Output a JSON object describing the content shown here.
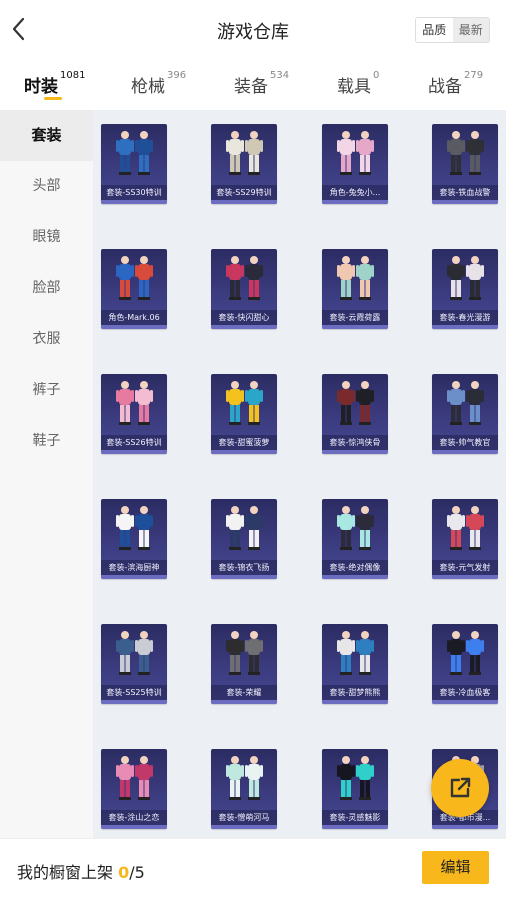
{
  "header": {
    "title": "游戏仓库",
    "toggle": [
      "品质",
      "最新"
    ]
  },
  "tabs": [
    {
      "label": "时装",
      "count": "1081"
    },
    {
      "label": "枪械",
      "count": "396"
    },
    {
      "label": "装备",
      "count": "534"
    },
    {
      "label": "载具",
      "count": "0"
    },
    {
      "label": "战备",
      "count": "279"
    }
  ],
  "sidebar": {
    "items": [
      "套装",
      "头部",
      "眼镜",
      "脸部",
      "衣服",
      "裤子",
      "鞋子"
    ]
  },
  "items": [
    {
      "label": "套装-SS30特训",
      "icon": "blue-suit-pair"
    },
    {
      "label": "套装-SS29特训",
      "icon": "white-suit-pair"
    },
    {
      "label": "角色-兔兔小...",
      "icon": "bunny-girl-figure"
    },
    {
      "label": "套装-铁血战警",
      "icon": "armor-suit-pair"
    },
    {
      "label": "角色-Mark.06",
      "icon": "blue-hero-figure"
    },
    {
      "label": "套装-快闪甜心",
      "icon": "pink-dark-suit-pair"
    },
    {
      "label": "套装-云霞荷露",
      "icon": "pastel-dress-pair"
    },
    {
      "label": "套装-春光漫游",
      "icon": "dark-suit-pair"
    },
    {
      "label": "套装-SS26特训",
      "icon": "pink-suit-pair"
    },
    {
      "label": "套装-甜蜜菠萝",
      "icon": "pineapple-costume-set"
    },
    {
      "label": "套装-惊鸿侠骨",
      "icon": "dark-robe-pair"
    },
    {
      "label": "套装-帅气教官",
      "icon": "blue-jacket-set"
    },
    {
      "label": "套装-滨海厨神",
      "icon": "chef-outfit"
    },
    {
      "label": "套装-锦衣飞扬",
      "icon": "white-robe-pair"
    },
    {
      "label": "套装-绝对偶像",
      "icon": "idol-pair"
    },
    {
      "label": "套装-元气发射",
      "icon": "red-white-pair"
    },
    {
      "label": "套装-SS25特训",
      "icon": "blue-camo-pair"
    },
    {
      "label": "套装-荣耀",
      "icon": "black-jacket-set"
    },
    {
      "label": "套装-甜梦熊熊",
      "icon": "bear-pajama-pair"
    },
    {
      "label": "套装-冷血极客",
      "icon": "black-tech-pair"
    },
    {
      "label": "套装-涂山之恋",
      "icon": "pink-fox-pair"
    },
    {
      "label": "套装-憎萌河马",
      "icon": "mint-pajama-pair"
    },
    {
      "label": "套装-灵感魅影",
      "icon": "dark-neon-pair"
    },
    {
      "label": "套装-都市漫...",
      "icon": "dark-urban-pair"
    }
  ],
  "footer": {
    "showcase_label": "我的橱窗上架",
    "current": "0",
    "separator": "/",
    "max": "5",
    "edit_label": "编辑"
  },
  "icons": {
    "back": "chevron-left-icon",
    "share": "share-external-icon"
  },
  "colors": {
    "accent": "#f8b81c",
    "card_bg": "#3f3f86"
  }
}
